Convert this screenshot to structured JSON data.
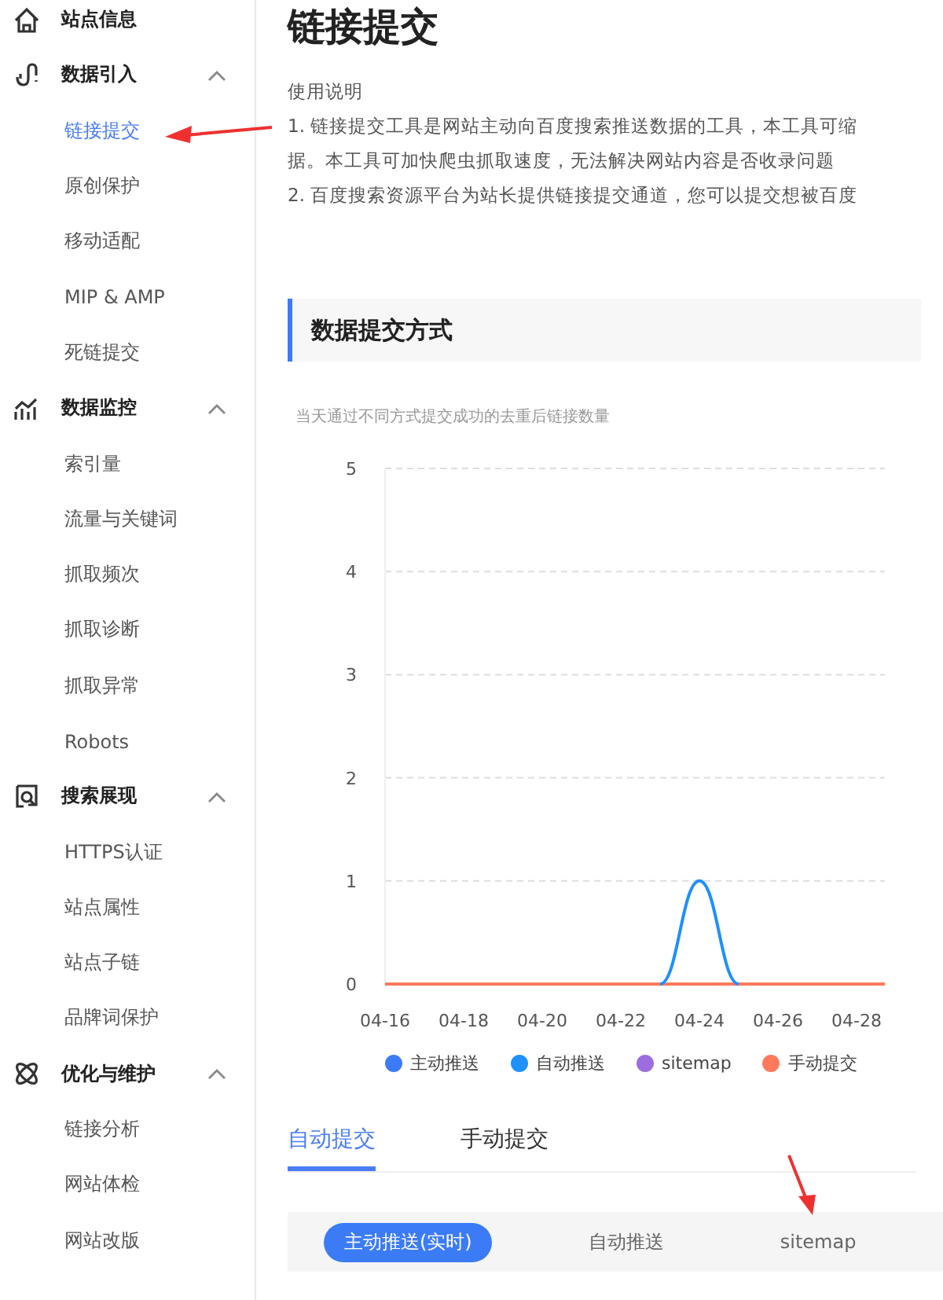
{
  "sidebar": {
    "sections": [
      {
        "kind": "link",
        "title": "站点信息"
      },
      {
        "kind": "group",
        "title": "数据引入",
        "expanded": true,
        "children": [
          {
            "label": "链接提交",
            "selected": true
          },
          {
            "label": "原创保护",
            "selected": false
          },
          {
            "label": "移动适配",
            "selected": false
          },
          {
            "label": "MIP & AMP",
            "selected": false
          },
          {
            "label": "死链提交",
            "selected": false
          }
        ]
      },
      {
        "kind": "group",
        "title": "数据监控",
        "expanded": true,
        "children": [
          {
            "label": "索引量",
            "selected": false
          },
          {
            "label": "流量与关键词",
            "selected": false
          },
          {
            "label": "抓取频次",
            "selected": false
          },
          {
            "label": "抓取诊断",
            "selected": false
          },
          {
            "label": "抓取异常",
            "selected": false
          },
          {
            "label": "Robots",
            "selected": false
          }
        ]
      },
      {
        "kind": "group",
        "title": "搜索展现",
        "expanded": true,
        "children": [
          {
            "label": "HTTPS认证",
            "selected": false
          },
          {
            "label": "站点属性",
            "selected": false
          },
          {
            "label": "站点子链",
            "selected": false
          },
          {
            "label": "品牌词保护",
            "selected": false
          }
        ]
      },
      {
        "kind": "group",
        "title": "优化与维护",
        "expanded": true,
        "children": [
          {
            "label": "链接分析",
            "selected": false
          },
          {
            "label": "网站体检",
            "selected": false
          },
          {
            "label": "网站改版",
            "selected": false
          }
        ]
      }
    ]
  },
  "page": {
    "title": "链接提交",
    "usage": {
      "heading": "使用说明",
      "lines": [
        "1. 链接提交工具是网站主动向百度搜索推送数据的工具，本工具可缩",
        "据。本工具可加快爬虫抓取速度，无法解决网站内容是否收录问题",
        "2. 百度搜索资源平台为站长提供链接提交通道，您可以提交想被百度"
      ]
    },
    "section": {
      "title": "数据提交方式",
      "subtitle": "当天通过不同方式提交成功的去重后链接数量",
      "chart_data": {
        "type": "line",
        "categories": [
          "04-16",
          null,
          "04-18",
          null,
          "04-20",
          null,
          "04-22",
          null,
          "04-24",
          null,
          "04-26",
          null,
          "04-28"
        ],
        "series": [
          {
            "name": "主动推送",
            "color": "#3c7bf6",
            "values": [
              null,
              null,
              null,
              null,
              null,
              null,
              null,
              null,
              null,
              null,
              null,
              null,
              null
            ]
          },
          {
            "name": "自动推送",
            "color": "#1e90ff",
            "values": [
              null,
              null,
              null,
              null,
              null,
              null,
              null,
              0,
              1,
              0,
              null,
              null,
              null
            ]
          },
          {
            "name": "sitemap",
            "color": "#9b6ddf",
            "values": [
              null,
              null,
              null,
              null,
              null,
              null,
              null,
              null,
              null,
              null,
              null,
              null,
              null
            ]
          },
          {
            "name": "手动提交",
            "color": "#ff7a5c",
            "values": [
              0,
              0,
              0,
              0,
              0,
              0,
              0,
              0,
              0,
              0,
              0,
              0,
              0
            ]
          }
        ],
        "ylim": [
          0,
          5
        ],
        "yticks": [
          0,
          1,
          2,
          3,
          4,
          5
        ],
        "grid": true
      }
    },
    "tabs": [
      {
        "label": "自动提交",
        "selected": true
      },
      {
        "label": "手动提交",
        "selected": false
      }
    ],
    "methods": [
      {
        "label": "主动推送(实时)",
        "selected": true
      },
      {
        "label": "自动推送",
        "selected": false
      },
      {
        "label": "sitemap",
        "selected": false
      }
    ]
  }
}
